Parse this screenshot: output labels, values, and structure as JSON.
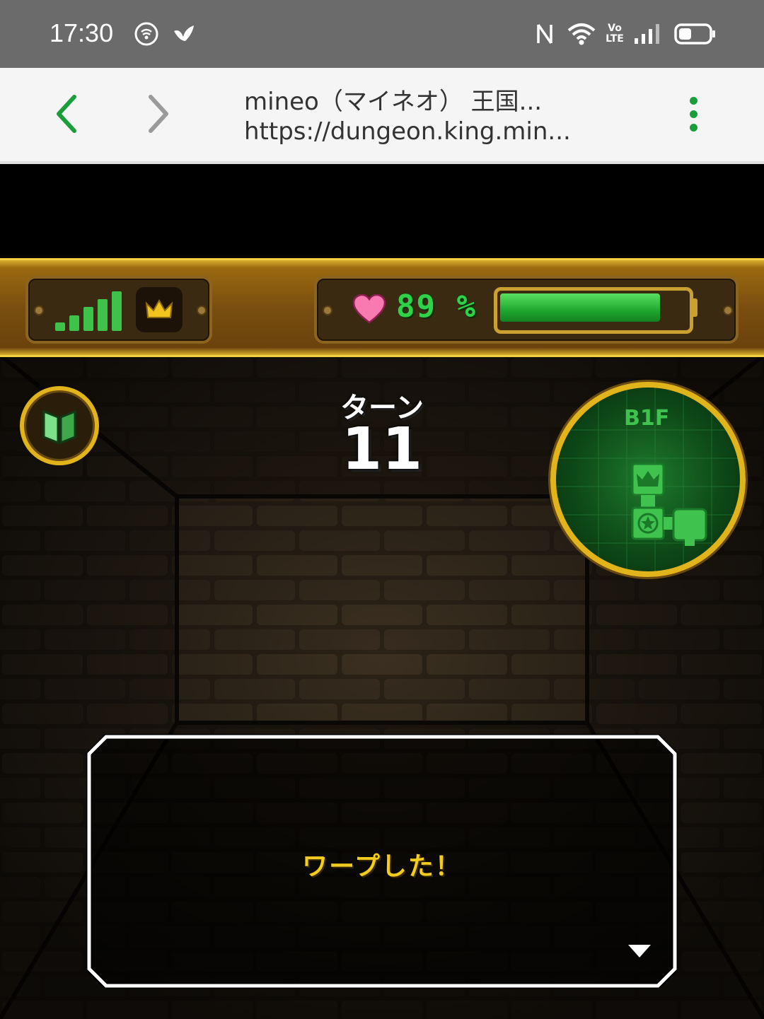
{
  "status_bar": {
    "time": "17:30",
    "icons": [
      "hotspot-icon",
      "bird-icon",
      "nfc-icon",
      "wifi-icon",
      "volte-icon",
      "cell-signal-icon",
      "battery-icon"
    ],
    "volte_top": "Vo",
    "volte_bottom": "LTE"
  },
  "browser": {
    "title": "mineo（マイネオ） 王国...",
    "url": "https://dungeon.king.min...",
    "back_icon": "chevron-left-icon",
    "forward_icon": "chevron-right-icon",
    "menu_icon": "more-vert-icon",
    "accent": "#1a9e3a"
  },
  "game": {
    "hud": {
      "signal_level": 5,
      "hp_percent_text": "89",
      "percent_sign": "%",
      "hp_fraction": 0.89,
      "icons": [
        "signal-bars-icon",
        "crown-icon",
        "heart-icon",
        "battery-gauge-icon"
      ]
    },
    "turn_label": "ターン",
    "turn_value": "11",
    "floor": "B1F",
    "message": "ワープした！",
    "colors": {
      "gold": "#e2b41c",
      "hp_green": "#2fd34a",
      "message_yellow": "#f2cc1e"
    }
  }
}
